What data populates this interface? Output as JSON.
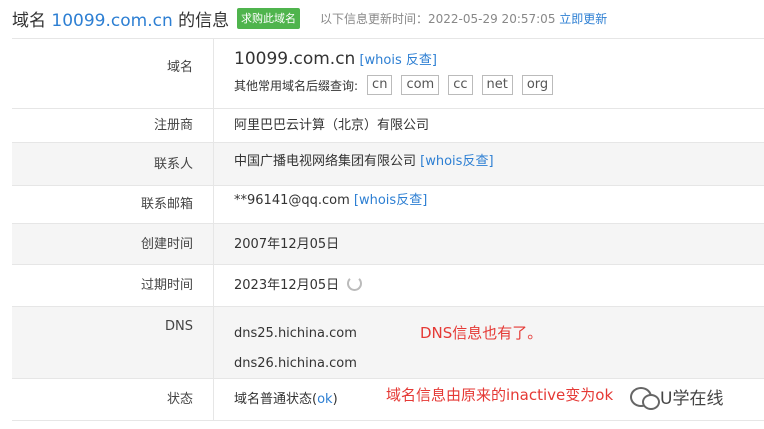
{
  "header": {
    "title_prefix": "域名",
    "domain": "10099.com.cn",
    "title_suffix": "的信息",
    "buy_badge": "求购此域名",
    "update_text": "以下信息更新时间：2022-05-29 20:57:05",
    "refresh_link": "立即更新"
  },
  "rows": {
    "domain": {
      "label": "域名",
      "value": "10099.com.cn",
      "whois_link": "[whois 反查]",
      "suffix_label": "其他常用域名后缀查询:",
      "suffixes": [
        "cn",
        "com",
        "cc",
        "net",
        "org"
      ]
    },
    "registrar": {
      "label": "注册商",
      "value": "阿里巴巴云计算（北京）有限公司"
    },
    "contact": {
      "label": "联系人",
      "value": "中国广播电视网络集团有限公司",
      "whois_link": "[whois反查]"
    },
    "email": {
      "label": "联系邮箱",
      "value": "**96141@qq.com",
      "whois_link": "[whois反查]"
    },
    "created": {
      "label": "创建时间",
      "value": "2007年12月05日"
    },
    "expires": {
      "label": "过期时间",
      "value": "2023年12月05日"
    },
    "dns": {
      "label": "DNS",
      "values": [
        "dns25.hichina.com",
        "dns26.hichina.com"
      ]
    },
    "status": {
      "label": "状态",
      "value_prefix": "域名普通状态(",
      "value_link": "ok",
      "value_suffix": ")"
    }
  },
  "annotations": {
    "dns_note": "DNS信息也有了。",
    "status_note": "域名信息由原来的inactive变为ok"
  },
  "watermark": {
    "text": "U学在线"
  },
  "colors": {
    "accent": "#2d7fd3",
    "badge": "#4fb44d",
    "note": "#e53935"
  }
}
